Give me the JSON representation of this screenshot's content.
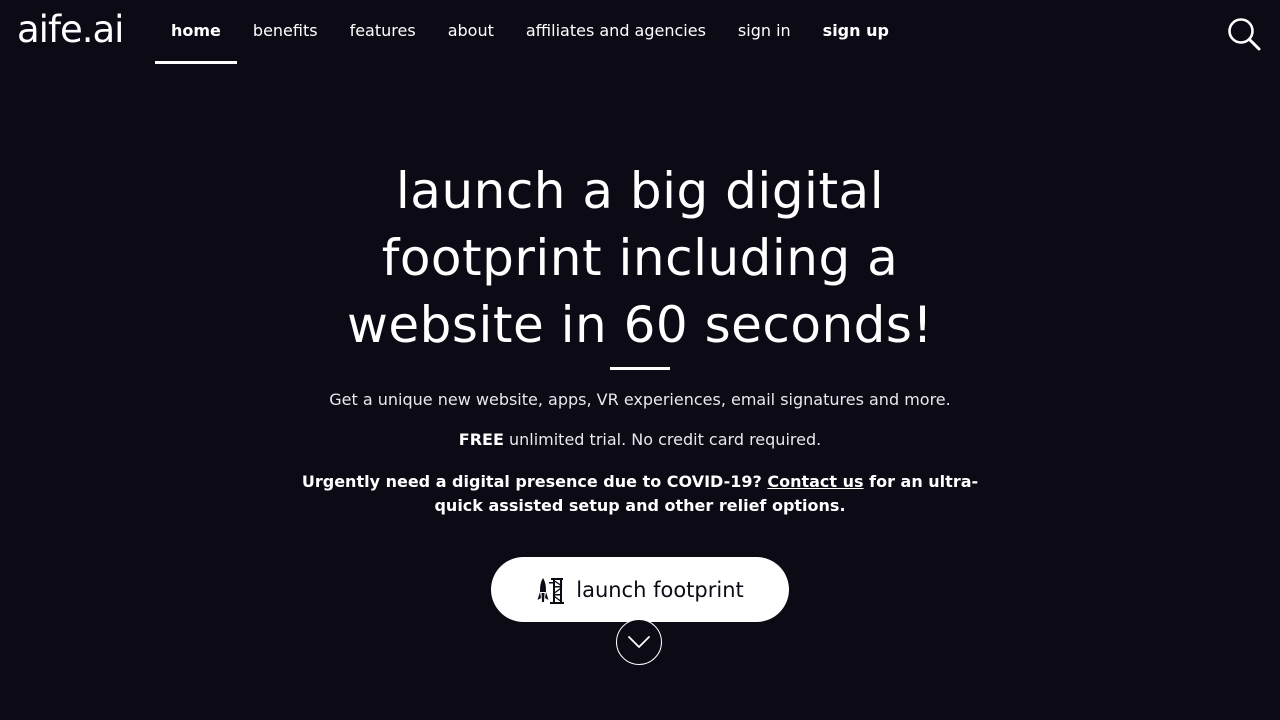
{
  "header": {
    "logo_text": "aife.ai",
    "nav": [
      {
        "label": "home",
        "active": true
      },
      {
        "label": "benefits"
      },
      {
        "label": "features"
      },
      {
        "label": "about"
      },
      {
        "label": "affiliates and agencies"
      },
      {
        "label": "sign in"
      },
      {
        "label": "sign up",
        "bold": true
      }
    ],
    "search_icon": "search-icon"
  },
  "hero": {
    "title_line1": "launch a big digital",
    "title_line2": "footprint including a",
    "title_line3": "website in 60 seconds!",
    "subtitle": "Get a unique new website, apps, VR experiences, email signatures and more.",
    "trial_strong": "FREE",
    "trial_rest": " unlimited trial. No credit card required.",
    "covid_prefix": "Urgently need a digital presence due to COVID-19? ",
    "covid_link": "Contact us",
    "covid_suffix": " for an ultra-quick assisted setup and other relief options.",
    "cta_label": "launch footprint",
    "cta_icon": "rocket-launch-icon",
    "scroll_icon": "chevron-down-icon"
  },
  "colors": {
    "background": "#0b0a15",
    "text": "#ffffff",
    "button_bg": "#ffffff",
    "button_text": "#0b0a15"
  }
}
